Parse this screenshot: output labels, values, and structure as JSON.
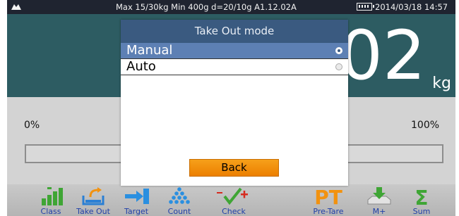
{
  "status_bar": {
    "info": "Max 15/30kg  Min 400g  d=20/10g   A1.12.02A",
    "datetime": "2014/03/18  14:57"
  },
  "weight": {
    "value": "02",
    "unit": "kg"
  },
  "progress": {
    "min_label": "0%",
    "max_label": "100%",
    "fraction": 0.0
  },
  "dialog": {
    "title": "Take Out mode",
    "options": [
      {
        "label": "Manual",
        "selected": true
      },
      {
        "label": "Auto",
        "selected": false
      }
    ],
    "back_label": "Back"
  },
  "toolbar": {
    "items": [
      {
        "label": "Class",
        "icon": "class-bars-icon"
      },
      {
        "label": "Take Out",
        "icon": "take-out-tray-icon"
      },
      {
        "label": "Target",
        "icon": "target-arrow-icon"
      },
      {
        "label": "Count",
        "icon": "count-balls-icon"
      },
      {
        "label": "Check",
        "icon": "check-mark-icon"
      },
      {
        "label": "Pre-Tare",
        "icon": "pre-tare-pt-icon"
      },
      {
        "label": "M+",
        "icon": "memory-plus-icon"
      },
      {
        "label": "Sum",
        "icon": "sum-sigma-icon"
      }
    ]
  },
  "colors": {
    "weight_panel": "#2d5c62",
    "dialog_title": "#3a5a80",
    "selected_option": "#5d80b4",
    "back_button": "#f2920f",
    "toolbar_label": "#1f3fa8"
  }
}
